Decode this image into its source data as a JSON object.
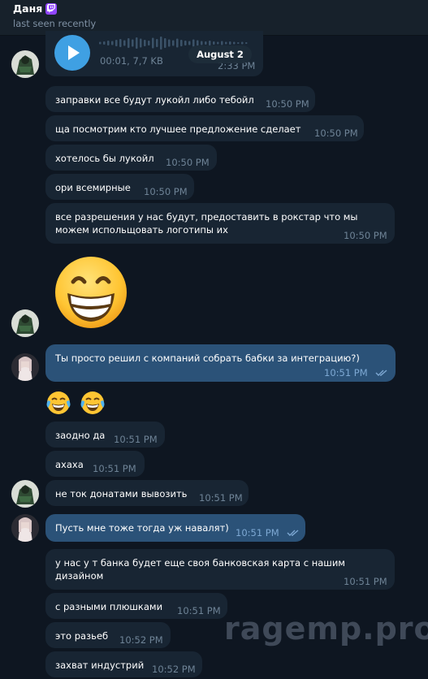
{
  "header": {
    "name": "Даня",
    "status": "last seen recently",
    "badge_icon": "twitch-icon",
    "badge_color": "#9146ff"
  },
  "voice_message": {
    "duration": "00:01",
    "size": "7,7 KB",
    "time": "2:33 PM",
    "accent": "#3fa0e3"
  },
  "date_separator": "August 2",
  "messages": [
    {
      "text": "заправки все будут лукойл либо тебойл",
      "time": "10:50 PM"
    },
    {
      "text": "ща посмотрим кто лучшее предложение сделает",
      "time": "10:50 PM"
    },
    {
      "text": "хотелось бы лукойл",
      "time": "10:50 PM"
    },
    {
      "text": "ори всемирные",
      "time": "10:50 PM"
    },
    {
      "text": "все разрешения у нас будут, предоставить в рокстар что мы можем испольщовать логотипы их",
      "time": "10:50 PM"
    },
    {
      "text": "Ты просто решил с компаний собрать бабки за интеграцию?)",
      "time": "10:51 PM"
    },
    {
      "text": "заодно да",
      "time": "10:51 PM"
    },
    {
      "text": "ахаха",
      "time": "10:51 PM"
    },
    {
      "text": "не ток донатами вывозить",
      "time": "10:51 PM"
    },
    {
      "text": "Пусть мне тоже тогда уж навалят)",
      "time": "10:51 PM"
    },
    {
      "text": "у нас у т банка будет еще своя банковская карта с нашим дизайном",
      "time": "10:51 PM"
    },
    {
      "text": "с разными плюшками",
      "time": "10:51 PM"
    },
    {
      "text": "это разьеб",
      "time": "10:52 PM"
    },
    {
      "text": "захват индустрий",
      "time": "10:52 PM"
    }
  ],
  "stickers": {
    "big": "grinning-face-emoji",
    "small": [
      "laughing-crying-emoji",
      "laughing-crying-emoji"
    ]
  },
  "watermark": "ragemp.pro",
  "colors": {
    "background": "#0e1621",
    "incoming_bubble": "#182533",
    "outgoing_bubble": "#2b5278",
    "read_checks": "#7da8d3"
  }
}
